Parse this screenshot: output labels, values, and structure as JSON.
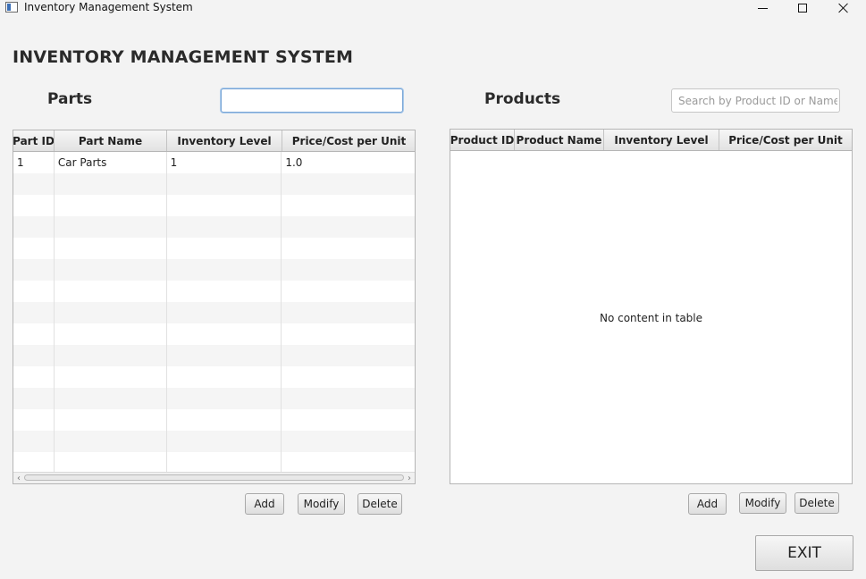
{
  "window": {
    "title": "Inventory Management System",
    "icon": "app-window-icon"
  },
  "header": {
    "title": "INVENTORY MANAGEMENT SYSTEM"
  },
  "parts": {
    "title": "Parts",
    "search": {
      "value": "",
      "placeholder": ""
    },
    "columns": [
      "Part ID",
      "Part Name",
      "Inventory Level",
      "Price/Cost per Unit"
    ],
    "rows": [
      {
        "id": "1",
        "name": "Car Parts",
        "inventory": "1",
        "price": "1.0"
      }
    ],
    "buttons": {
      "add": "Add",
      "modify": "Modify",
      "delete": "Delete"
    }
  },
  "products": {
    "title": "Products",
    "search": {
      "value": "",
      "placeholder": "Search by Product ID or Name"
    },
    "columns": [
      "Product ID",
      "Product Name",
      "Inventory Level",
      "Price/Cost per Unit"
    ],
    "rows": [],
    "empty_message": "No content in table",
    "buttons": {
      "add": "Add",
      "modify": "Modify",
      "delete": "Delete"
    }
  },
  "footer": {
    "exit_label": "EXIT"
  }
}
